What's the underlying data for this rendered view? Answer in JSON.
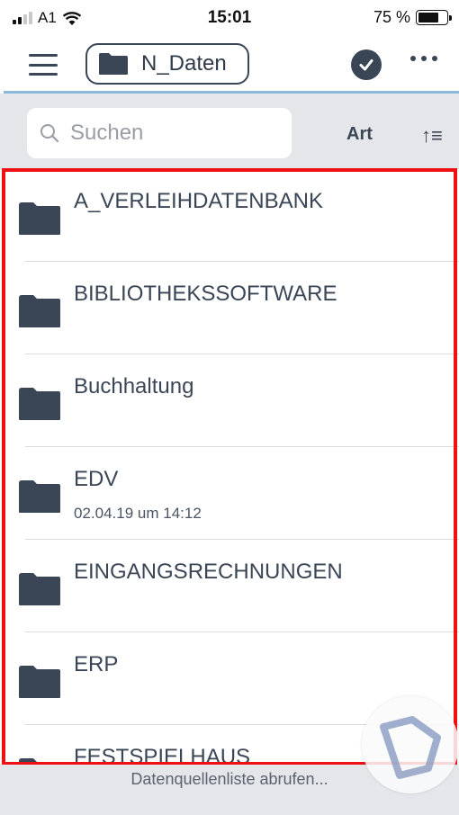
{
  "status_bar": {
    "carrier": "A1",
    "time": "15:01",
    "battery_text": "75 %",
    "battery_level": 0.75
  },
  "nav": {
    "title": "N_Daten",
    "menu_icon": "hamburger-menu-icon",
    "confirm_icon": "checkmark-circle-icon",
    "more_icon": "more-dots-icon"
  },
  "search": {
    "placeholder": "Suchen",
    "icon": "search-icon"
  },
  "sort": {
    "type_label": "Art",
    "order_label": "↑≡"
  },
  "items": [
    {
      "name": "A_VERLEIHDATENBANK",
      "meta": ""
    },
    {
      "name": "BIBLIOTHEKSSOFTWARE",
      "meta": ""
    },
    {
      "name": "Buchhaltung",
      "meta": ""
    },
    {
      "name": "EDV",
      "meta": "02.04.19 um 14:12"
    },
    {
      "name": "EINGANGSRECHNUNGEN",
      "meta": ""
    },
    {
      "name": "ERP",
      "meta": ""
    },
    {
      "name": "FESTSPIELHAUS",
      "meta": ""
    }
  ],
  "footer": {
    "status_text": "Datenquellenliste abrufen..."
  },
  "colors": {
    "primary": "#3a4656",
    "accent_line": "#8ab9dc",
    "highlight": "#ee1111",
    "toolbar_bg": "#e5e6e9"
  }
}
